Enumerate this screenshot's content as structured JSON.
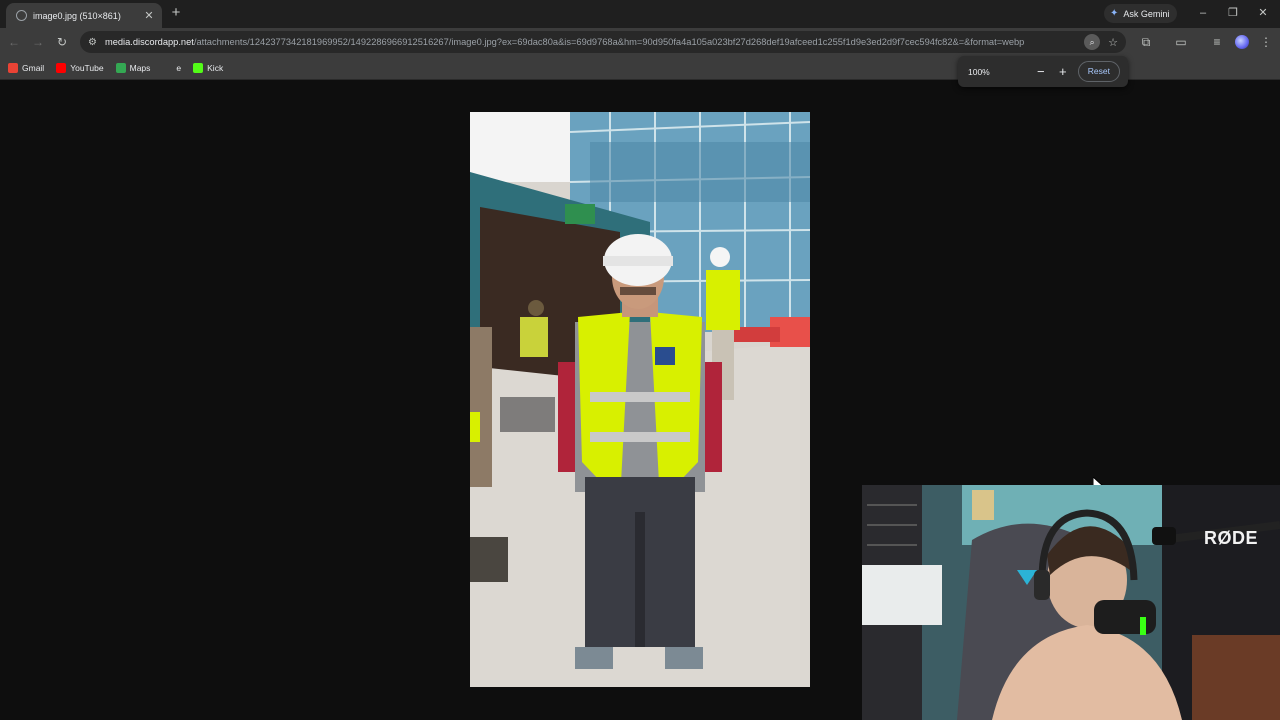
{
  "browser": {
    "tab": {
      "title": "image0.jpg (510×861)",
      "close_glyph": "✕"
    },
    "new_tab_glyph": "+",
    "gemini_label": "Ask Gemini",
    "window_controls": {
      "minimize": "–",
      "restore": "❐",
      "close": "✕"
    },
    "url_host": "media.discordapp.net",
    "url_path": "/attachments/1242377342181969952/1492286966912516267/image0.jpg?ex=69dac80a&is=69d9768a&hm=90d950fa4a105a023bf27d268def19afceed1c255f1d9e3ed2d9f7cec594fc82&=&format=webp",
    "nav": {
      "back": "←",
      "forward": "→",
      "reload": "↻",
      "site_info": "⚙"
    },
    "bookmarks": [
      {
        "label": "Gmail",
        "icon": "gmail-icon",
        "color": "#ea4335"
      },
      {
        "label": "YouTube",
        "icon": "youtube-icon",
        "color": "#ff0000"
      },
      {
        "label": "Maps",
        "icon": "maps-icon",
        "color": "#34a853"
      },
      {
        "label": "e",
        "icon": "generic-icon",
        "color": "#3c3c3c"
      },
      {
        "label": "Kick",
        "icon": "kick-icon",
        "color": "#53fc18"
      }
    ]
  },
  "zoom_popup": {
    "level": "100%",
    "minus": "−",
    "plus": "+",
    "reset_label": "Reset"
  },
  "webcam": {
    "mic_brand": "RØDE"
  },
  "colors": {
    "accent": "#a8c7fa",
    "page_bg": "#0e0e0e",
    "chrome_bg": "#3c3c3c",
    "vest": "#d8f000"
  }
}
